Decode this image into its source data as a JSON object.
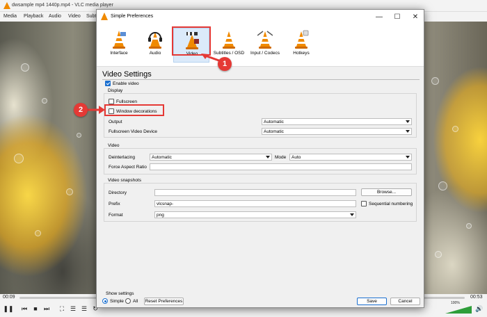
{
  "vlc": {
    "title": "dwsample mp4 1440p.mp4 - VLC media player",
    "menu": [
      "Media",
      "Playback",
      "Audio",
      "Video",
      "Subt"
    ],
    "time_elapsed": "00:09",
    "time_total": "00:53",
    "volume_label": "100%",
    "volume_level": 1.0
  },
  "dialog": {
    "title": "Simple Preferences",
    "window_buttons": {
      "minimize": "—",
      "maximize": "☐",
      "close": "✕"
    },
    "tabs": [
      {
        "label": "Interface"
      },
      {
        "label": "Audio"
      },
      {
        "label": "Video"
      },
      {
        "label": "Subtitles / OSD"
      },
      {
        "label": "Input / Codecs"
      },
      {
        "label": "Hotkeys"
      }
    ],
    "active_tab": "Video",
    "section_title": "Video Settings",
    "enable_video_label": "Enable video",
    "enable_video_checked": true,
    "display": {
      "title": "Display",
      "fullscreen_label": "Fullscreen",
      "fullscreen_checked": false,
      "window_decorations_label": "Window decorations",
      "window_decorations_checked": false,
      "output_label": "Output",
      "output_value": "Automatic",
      "fullscreen_device_label": "Fullscreen Video Device",
      "fullscreen_device_value": "Automatic"
    },
    "video": {
      "title": "Video",
      "deinterlacing_label": "Deinterlacing",
      "deinterlacing_value": "Automatic",
      "mode_label": "Mode",
      "mode_value": "Auto",
      "aspect_label": "Force Aspect Ratio",
      "aspect_value": ""
    },
    "snapshots": {
      "title": "Video snapshots",
      "directory_label": "Directory",
      "directory_value": "",
      "browse_label": "Browse...",
      "prefix_label": "Prefix",
      "prefix_value": "vlcsnap-",
      "sequential_label": "Sequential numbering",
      "sequential_checked": false,
      "format_label": "Format",
      "format_value": "png"
    },
    "show_settings": {
      "title": "Show settings",
      "simple_label": "Simple",
      "all_label": "All",
      "selected": "Simple"
    },
    "reset_label": "Reset Preferences",
    "save_label": "Save",
    "cancel_label": "Cancel"
  },
  "annotations": {
    "marker_1": "1",
    "marker_2": "2",
    "color": "#e53935"
  },
  "colors": {
    "accent": "#1a6fd0",
    "vlc_orange": "#f08a00",
    "annotation_red": "#e53935"
  }
}
